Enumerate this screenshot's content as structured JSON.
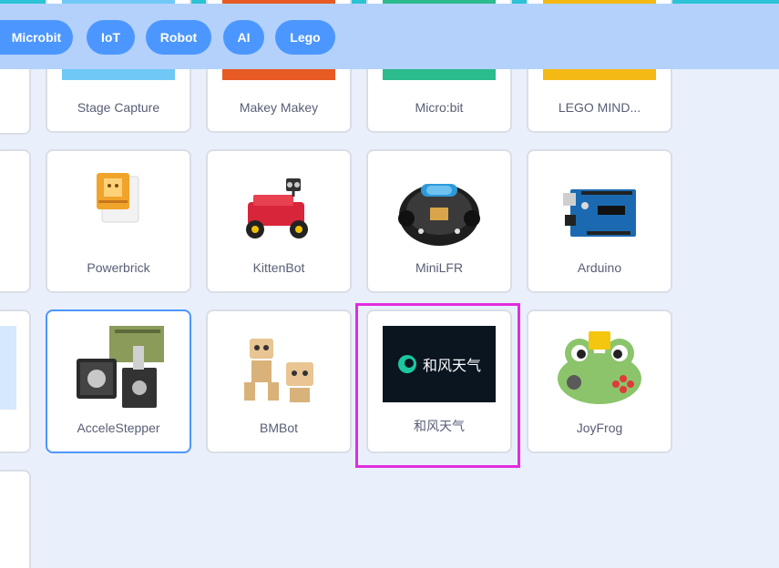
{
  "filters": [
    {
      "label": "Microbit"
    },
    {
      "label": "IoT"
    },
    {
      "label": "Robot"
    },
    {
      "label": "AI"
    },
    {
      "label": "Lego"
    }
  ],
  "extensions": {
    "row0": [
      "Stage Capture",
      "Makey Makey",
      "Micro:bit",
      "LEGO MIND..."
    ],
    "row1": [
      "Powerbrick",
      "KittenBot",
      "MiniLFR",
      "Arduino"
    ],
    "row2": [
      "AcceleStepper",
      "BMBot",
      "和风天气",
      "JoyFrog"
    ]
  },
  "qweather_logo_text": "和风天气",
  "colors": {
    "accent": "#4c97ff",
    "filter_bar": "#b3d1fb",
    "highlight": "#e22de0",
    "label_text": "#575e75"
  }
}
